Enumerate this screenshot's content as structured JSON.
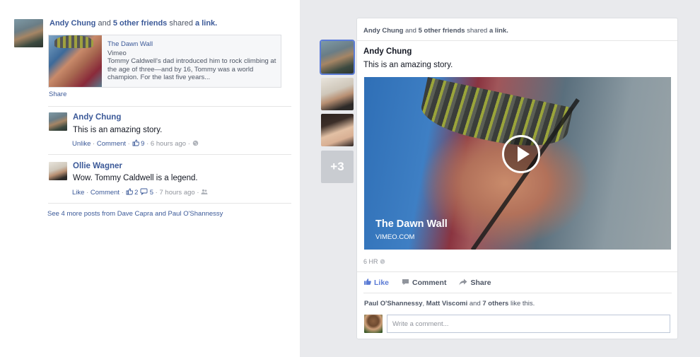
{
  "left": {
    "header": {
      "actor": "Andy Chung",
      "and": "and",
      "others": "5 other friends",
      "verb": "shared",
      "object": "a link."
    },
    "share": {
      "title": "The Dawn Wall",
      "source": "Vimeo",
      "description": "Tommy Caldwell's dad introduced him to rock climbing at the age of three—and by 16, Tommy was a world champion. For the last five years...",
      "share_label": "Share"
    },
    "comments": [
      {
        "name": "Andy Chung",
        "text": "This is an amazing story.",
        "action1": "Unlike",
        "action2": "Comment",
        "likes": "9",
        "time": "6 hours ago"
      },
      {
        "name": "Ollie Wagner",
        "text": "Wow. Tommy Caldwell is a legend.",
        "action1": "Like",
        "action2": "Comment",
        "likes": "2",
        "replies": "5",
        "time": "7 hours ago"
      }
    ],
    "see_more": "See 4 more posts from Dave Capra and Paul O'Shannessy"
  },
  "thumbs": {
    "more_count": "+3"
  },
  "card": {
    "header": {
      "actor": "Andy Chung",
      "and": "and",
      "others": "5 other friends",
      "verb": "shared",
      "object": "a link."
    },
    "author": "Andy Chung",
    "story": "This is an amazing story.",
    "video_title": "The Dawn Wall",
    "video_source": "VIMEO.COM",
    "time": "6 HR",
    "actions": {
      "like": "Like",
      "comment": "Comment",
      "share": "Share"
    },
    "likes_line": {
      "p1": "Paul O'Shannessy",
      "comma": ",",
      "p2": "Matt Viscomi",
      "and": "and",
      "others": "7 others",
      "tail": "like this."
    },
    "comment_placeholder": "Write a comment..."
  },
  "colors": {
    "link": "#3b5998",
    "like_active": "#5b7bd5",
    "background": "#e9eaed"
  }
}
